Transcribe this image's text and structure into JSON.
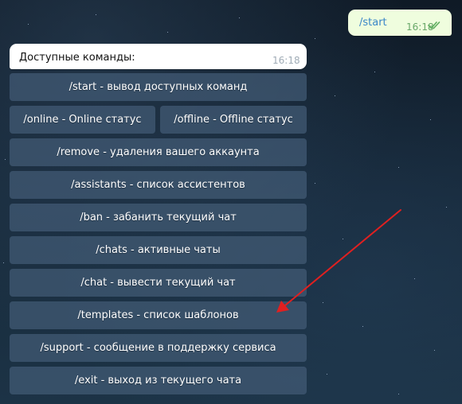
{
  "outgoing": {
    "text": "/start",
    "time": "16:18"
  },
  "incoming": {
    "text": "Доступные команды:",
    "time": "16:18"
  },
  "keyboard": [
    "/start - вывод доступных команд",
    "/online - Online статус",
    "/offline - Offline статус",
    "/remove - удаления вашего аккаунта",
    "/assistants - список ассистентов",
    "/ban - забанить текущий чат",
    "/chats - активные чаты",
    "/chat - вывести текущий чат",
    "/templates - список шаблонов",
    "/support - сообщение в поддержку сервиса",
    "/exit - выход из текущего чата"
  ],
  "annotation": {
    "color": "#e02020"
  }
}
